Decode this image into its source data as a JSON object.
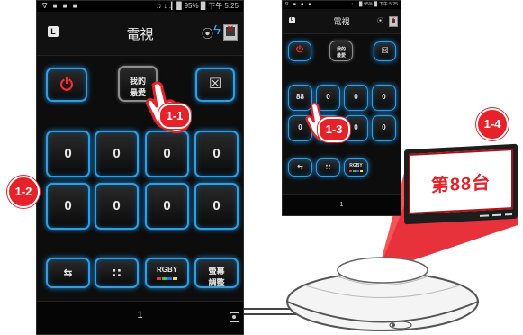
{
  "phone_main": {
    "status_left": "∇ ■ ■ ■",
    "status_right": "♫ ↕ .▎▉ 95% ▉ 下午 5:25",
    "app_logo": "L",
    "title": "電視",
    "mute_label": "☒",
    "power_label": "⏻",
    "fav_label_line1": "我的",
    "fav_label_line2": "最愛",
    "digit_keys": [
      "0",
      "0",
      "0",
      "0",
      "0",
      "0",
      "0",
      "0"
    ],
    "rgby_label": "RGBY",
    "screen_adjust_line1": "螢幕",
    "screen_adjust_line2": "調整",
    "page_number": "1"
  },
  "phone_secondary": {
    "status_left": "∇ ■ ■ ■",
    "status_right": "↕ .▎▉ 95% ▉ 下午 5:25",
    "app_logo": "L",
    "title": "電視",
    "fav_label_line1": "我的",
    "fav_label_line2": "最愛",
    "digit_keys": [
      "88",
      "0",
      "0",
      "0",
      "0",
      "0",
      "0",
      "0"
    ],
    "rgby_label": "RGBY",
    "page_number": "1"
  },
  "callouts": {
    "step1": "1-1",
    "step2": "1-2",
    "step3": "1-3",
    "step4": "1-4"
  },
  "tv_screen_text": "第88台",
  "colors": {
    "accent_blue": "#2f9fe0",
    "callout_red": "#e5212a",
    "power_red": "#ff2b2b"
  }
}
